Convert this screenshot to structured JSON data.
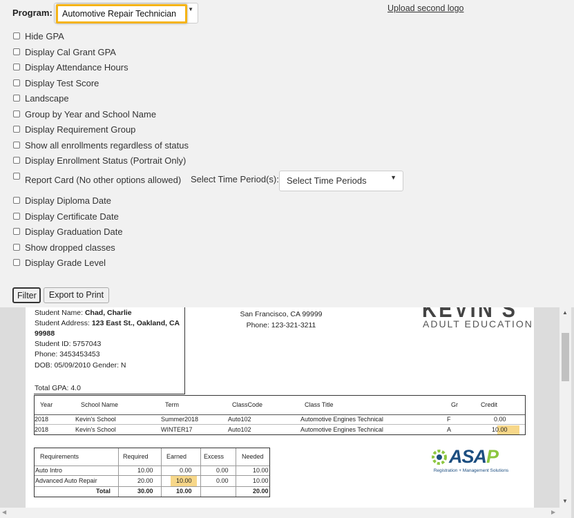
{
  "program": {
    "label": "Program:",
    "selected": "Automotive Repair Technician"
  },
  "upload_logo_link": "Upload second logo",
  "options": [
    {
      "label": "Hide GPA",
      "checked": false
    },
    {
      "label": "Display Cal Grant GPA",
      "checked": false
    },
    {
      "label": "Display Attendance Hours",
      "checked": false
    },
    {
      "label": "Display Test Score",
      "checked": false
    },
    {
      "label": "Landscape",
      "checked": false
    },
    {
      "label": "Group by Year and School Name",
      "checked": false
    },
    {
      "label": "Display Requirement Group",
      "checked": false
    },
    {
      "label": "Show all enrollments regardless of status",
      "checked": false
    },
    {
      "label": "Display Enrollment Status (Portrait Only)",
      "checked": false
    },
    {
      "label": "Report Card (No other options allowed)",
      "checked": false
    },
    {
      "label": "Display Diploma Date",
      "checked": false
    },
    {
      "label": "Display Certificate Date",
      "checked": false
    },
    {
      "label": "Display Graduation Date",
      "checked": false
    },
    {
      "label": "Show dropped classes",
      "checked": false
    },
    {
      "label": "Display Grade Level",
      "checked": false
    }
  ],
  "time_period": {
    "label": "Select Time Period(s):",
    "placeholder": "Select Time Periods"
  },
  "buttons": {
    "filter": "Filter",
    "export": "Export to Print"
  },
  "report": {
    "student": {
      "name_label": "Student Name:",
      "name": "Chad, Charlie",
      "address_label": "Student Address:",
      "address_line1": "123 East St., Oakland, CA",
      "address_line2": "99988",
      "id": "Student ID: 5757043",
      "phone": "Phone: 3453453453",
      "dob": "DOB: 05/09/2010 Gender: N",
      "gpa": "Total GPA: 4.0"
    },
    "school_address": {
      "city": "San Francisco, CA 99999",
      "phone": "Phone: 123-321-3211"
    },
    "school_logo": {
      "name": "KEVIN'S",
      "subtitle": "ADULT EDUCATION"
    },
    "classes": {
      "headers": [
        "Year",
        "School Name",
        "Term",
        "ClassCode",
        "Class Title",
        "Gr",
        "Credit"
      ],
      "rows": [
        [
          "2018",
          "Kevin's School",
          "Summer2018",
          "Auto102",
          "Automotive Engines Technical",
          "F",
          "0.00"
        ],
        [
          "2018",
          "Kevin's School",
          "WINTER17",
          "Auto102",
          "Automotive Engines Technical",
          "A",
          "10.00"
        ]
      ]
    },
    "requirements": {
      "headers": [
        "Requirements",
        "Required",
        "Earned",
        "Excess",
        "Needed"
      ],
      "rows": [
        [
          "Auto Intro",
          "10.00",
          "0.00",
          "0.00",
          "10.00"
        ],
        [
          "Advanced Auto Repair",
          "20.00",
          "10.00",
          "0.00",
          "10.00"
        ]
      ],
      "total": [
        "Total",
        "30.00",
        "10.00",
        "",
        "20.00"
      ]
    },
    "asap_logo": {
      "text": "ASA",
      "p": "P",
      "tagline": "Registration + Management Solutions"
    }
  },
  "colors": {
    "highlight_border": "#f5b415",
    "cell_highlight": "#f7d789",
    "asap_blue": "#1c4e80",
    "asap_green": "#8cc63f"
  }
}
